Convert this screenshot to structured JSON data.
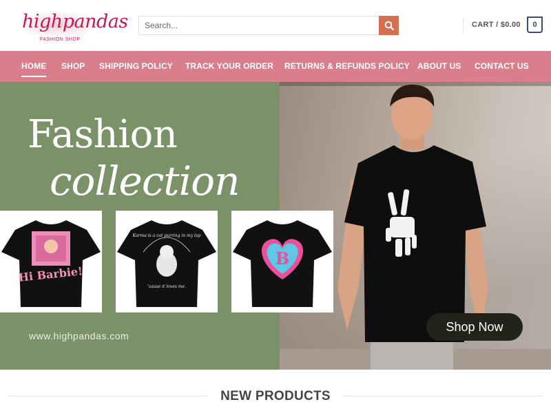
{
  "logo": {
    "script": "highpandas",
    "subtitle": "FASHION SHOP"
  },
  "search": {
    "placeholder": "Search..."
  },
  "cart": {
    "label": "CART / $0.00",
    "count": "0"
  },
  "nav": {
    "items": [
      "HOME",
      "SHOP",
      "SHIPPING POLICY",
      "TRACK YOUR ORDER",
      "RETURNS & REFUNDS POLICY",
      "ABOUT US",
      "CONTACT US"
    ],
    "active": "HOME"
  },
  "banner": {
    "title_line1": "Fashion",
    "title_line2": "collection",
    "website": "www.highpandas.com",
    "cta": "Shop Now",
    "shirts": [
      {
        "text": "Hi Barbie!"
      },
      {
        "text": "Karma is a cat purring in my lap 'cause it loves me."
      },
      {
        "text": "B"
      }
    ]
  },
  "section": {
    "title": "NEW PRODUCTS"
  },
  "colors": {
    "nav_bg": "#d87f8b",
    "banner_green": "#7b9168",
    "search_button": "#d2704f",
    "brand_pink": "#c2185b"
  }
}
